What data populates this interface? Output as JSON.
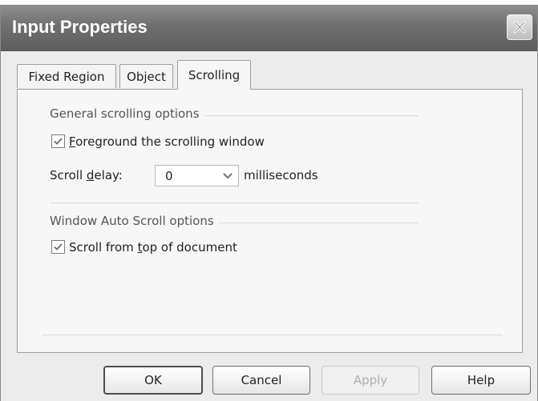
{
  "window": {
    "title": "Input Properties"
  },
  "tabs": [
    {
      "label": "Fixed Region"
    },
    {
      "label": "Object"
    },
    {
      "label": "Scrolling",
      "active": true
    }
  ],
  "general": {
    "group_label": "General scrolling options",
    "foreground": {
      "label_u": "F",
      "label_rest": "oreground the scrolling window",
      "checked": true
    },
    "scroll_delay": {
      "label_pre": "Scroll ",
      "label_u": "d",
      "label_post": "elay:",
      "value": "0",
      "unit": "milliseconds"
    }
  },
  "auto_scroll": {
    "group_label": "Window Auto Scroll options",
    "from_top": {
      "label_pre": "Scroll from ",
      "label_u": "t",
      "label_post": "op of document",
      "checked": true
    }
  },
  "buttons": {
    "ok": "OK",
    "cancel": "Cancel",
    "apply": "Apply",
    "help": "Help"
  }
}
